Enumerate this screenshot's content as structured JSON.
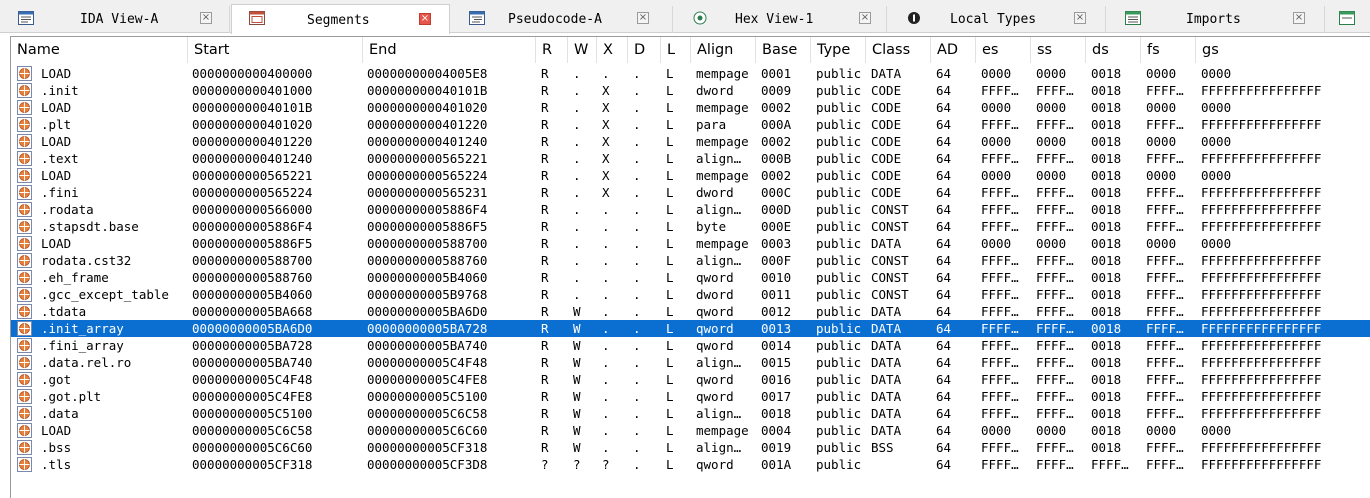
{
  "tabs": [
    {
      "label": "IDA View-A",
      "icon": "ida-view-icon",
      "active": false
    },
    {
      "label": "Segments",
      "icon": "segments-icon",
      "active": true
    },
    {
      "label": "Pseudocode-A",
      "icon": "pseudocode-icon",
      "active": false
    },
    {
      "label": "Hex View-1",
      "icon": "hex-view-icon",
      "active": false
    },
    {
      "label": "Local Types",
      "icon": "local-types-icon",
      "active": false
    },
    {
      "label": "Imports",
      "icon": "imports-icon",
      "active": false
    }
  ],
  "columns": [
    "Name",
    "Start",
    "End",
    "R",
    "W",
    "X",
    "D",
    "L",
    "Align",
    "Base",
    "Type",
    "Class",
    "AD",
    "es",
    "ss",
    "ds",
    "fs",
    "gs"
  ],
  "selected_row": 15,
  "colors": {
    "selection": "#0a6fd1",
    "active_close": "#e6564a"
  },
  "rows": [
    [
      "LOAD",
      "0000000000400000",
      "00000000004005E8",
      "R",
      ".",
      ".",
      ".",
      "L",
      "mempage",
      "0001",
      "public",
      "DATA",
      "64",
      "0000",
      "0000",
      "0018",
      "0000",
      "0000"
    ],
    [
      ".init",
      "0000000000401000",
      "000000000040101B",
      "R",
      ".",
      "X",
      ".",
      "L",
      "dword",
      "0009",
      "public",
      "CODE",
      "64",
      "FFFF…",
      "FFFF…",
      "0018",
      "FFFF…",
      "FFFFFFFFFFFFFFFF"
    ],
    [
      "LOAD",
      "000000000040101B",
      "0000000000401020",
      "R",
      ".",
      "X",
      ".",
      "L",
      "mempage",
      "0002",
      "public",
      "CODE",
      "64",
      "0000",
      "0000",
      "0018",
      "0000",
      "0000"
    ],
    [
      ".plt",
      "0000000000401020",
      "0000000000401220",
      "R",
      ".",
      "X",
      ".",
      "L",
      "para",
      "000A",
      "public",
      "CODE",
      "64",
      "FFFF…",
      "FFFF…",
      "0018",
      "FFFF…",
      "FFFFFFFFFFFFFFFF"
    ],
    [
      "LOAD",
      "0000000000401220",
      "0000000000401240",
      "R",
      ".",
      "X",
      ".",
      "L",
      "mempage",
      "0002",
      "public",
      "CODE",
      "64",
      "0000",
      "0000",
      "0018",
      "0000",
      "0000"
    ],
    [
      ".text",
      "0000000000401240",
      "0000000000565221",
      "R",
      ".",
      "X",
      ".",
      "L",
      "align…",
      "000B",
      "public",
      "CODE",
      "64",
      "FFFF…",
      "FFFF…",
      "0018",
      "FFFF…",
      "FFFFFFFFFFFFFFFF"
    ],
    [
      "LOAD",
      "0000000000565221",
      "0000000000565224",
      "R",
      ".",
      "X",
      ".",
      "L",
      "mempage",
      "0002",
      "public",
      "CODE",
      "64",
      "0000",
      "0000",
      "0018",
      "0000",
      "0000"
    ],
    [
      ".fini",
      "0000000000565224",
      "0000000000565231",
      "R",
      ".",
      "X",
      ".",
      "L",
      "dword",
      "000C",
      "public",
      "CODE",
      "64",
      "FFFF…",
      "FFFF…",
      "0018",
      "FFFF…",
      "FFFFFFFFFFFFFFFF"
    ],
    [
      ".rodata",
      "0000000000566000",
      "00000000005886F4",
      "R",
      ".",
      ".",
      ".",
      "L",
      "align…",
      "000D",
      "public",
      "CONST",
      "64",
      "FFFF…",
      "FFFF…",
      "0018",
      "FFFF…",
      "FFFFFFFFFFFFFFFF"
    ],
    [
      ".stapsdt.base",
      "00000000005886F4",
      "00000000005886F5",
      "R",
      ".",
      ".",
      ".",
      "L",
      "byte",
      "000E",
      "public",
      "CONST",
      "64",
      "FFFF…",
      "FFFF…",
      "0018",
      "FFFF…",
      "FFFFFFFFFFFFFFFF"
    ],
    [
      "LOAD",
      "00000000005886F5",
      "0000000000588700",
      "R",
      ".",
      ".",
      ".",
      "L",
      "mempage",
      "0003",
      "public",
      "DATA",
      "64",
      "0000",
      "0000",
      "0018",
      "0000",
      "0000"
    ],
    [
      "rodata.cst32",
      "0000000000588700",
      "0000000000588760",
      "R",
      ".",
      ".",
      ".",
      "L",
      "align…",
      "000F",
      "public",
      "CONST",
      "64",
      "FFFF…",
      "FFFF…",
      "0018",
      "FFFF…",
      "FFFFFFFFFFFFFFFF"
    ],
    [
      ".eh_frame",
      "0000000000588760",
      "00000000005B4060",
      "R",
      ".",
      ".",
      ".",
      "L",
      "qword",
      "0010",
      "public",
      "CONST",
      "64",
      "FFFF…",
      "FFFF…",
      "0018",
      "FFFF…",
      "FFFFFFFFFFFFFFFF"
    ],
    [
      ".gcc_except_table",
      "00000000005B4060",
      "00000000005B9768",
      "R",
      ".",
      ".",
      ".",
      "L",
      "dword",
      "0011",
      "public",
      "CONST",
      "64",
      "FFFF…",
      "FFFF…",
      "0018",
      "FFFF…",
      "FFFFFFFFFFFFFFFF"
    ],
    [
      ".tdata",
      "00000000005BA668",
      "00000000005BA6D0",
      "R",
      "W",
      ".",
      ".",
      "L",
      "qword",
      "0012",
      "public",
      "DATA",
      "64",
      "FFFF…",
      "FFFF…",
      "0018",
      "FFFF…",
      "FFFFFFFFFFFFFFFF"
    ],
    [
      ".init_array",
      "00000000005BA6D0",
      "00000000005BA728",
      "R",
      "W",
      ".",
      ".",
      "L",
      "qword",
      "0013",
      "public",
      "DATA",
      "64",
      "FFFF…",
      "FFFF…",
      "0018",
      "FFFF…",
      "FFFFFFFFFFFFFFFF"
    ],
    [
      ".fini_array",
      "00000000005BA728",
      "00000000005BA740",
      "R",
      "W",
      ".",
      ".",
      "L",
      "qword",
      "0014",
      "public",
      "DATA",
      "64",
      "FFFF…",
      "FFFF…",
      "0018",
      "FFFF…",
      "FFFFFFFFFFFFFFFF"
    ],
    [
      ".data.rel.ro",
      "00000000005BA740",
      "00000000005C4F48",
      "R",
      "W",
      ".",
      ".",
      "L",
      "align…",
      "0015",
      "public",
      "DATA",
      "64",
      "FFFF…",
      "FFFF…",
      "0018",
      "FFFF…",
      "FFFFFFFFFFFFFFFF"
    ],
    [
      ".got",
      "00000000005C4F48",
      "00000000005C4FE8",
      "R",
      "W",
      ".",
      ".",
      "L",
      "qword",
      "0016",
      "public",
      "DATA",
      "64",
      "FFFF…",
      "FFFF…",
      "0018",
      "FFFF…",
      "FFFFFFFFFFFFFFFF"
    ],
    [
      ".got.plt",
      "00000000005C4FE8",
      "00000000005C5100",
      "R",
      "W",
      ".",
      ".",
      "L",
      "qword",
      "0017",
      "public",
      "DATA",
      "64",
      "FFFF…",
      "FFFF…",
      "0018",
      "FFFF…",
      "FFFFFFFFFFFFFFFF"
    ],
    [
      ".data",
      "00000000005C5100",
      "00000000005C6C58",
      "R",
      "W",
      ".",
      ".",
      "L",
      "align…",
      "0018",
      "public",
      "DATA",
      "64",
      "FFFF…",
      "FFFF…",
      "0018",
      "FFFF…",
      "FFFFFFFFFFFFFFFF"
    ],
    [
      "LOAD",
      "00000000005C6C58",
      "00000000005C6C60",
      "R",
      "W",
      ".",
      ".",
      "L",
      "mempage",
      "0004",
      "public",
      "DATA",
      "64",
      "0000",
      "0000",
      "0018",
      "0000",
      "0000"
    ],
    [
      ".bss",
      "00000000005C6C60",
      "00000000005CF318",
      "R",
      "W",
      ".",
      ".",
      "L",
      "align…",
      "0019",
      "public",
      "BSS",
      "64",
      "FFFF…",
      "FFFF…",
      "0018",
      "FFFF…",
      "FFFFFFFFFFFFFFFF"
    ],
    [
      ".tls",
      "00000000005CF318",
      "00000000005CF3D8",
      "?",
      "?",
      "?",
      ".",
      "L",
      "qword",
      "001A",
      "public",
      "",
      "64",
      "FFFF…",
      "FFFF…",
      "FFFF…",
      "FFFF…",
      "FFFFFFFFFFFFFFFF"
    ]
  ]
}
